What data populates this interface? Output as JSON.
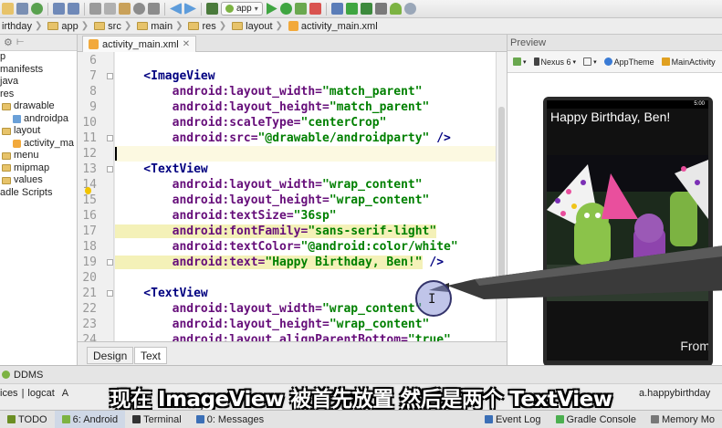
{
  "toolbar": {
    "run_config": "app",
    "icon_names": [
      "folder-open-icon",
      "save-icon",
      "sync-icon",
      "undo-icon",
      "redo-icon",
      "cut-icon",
      "copy-icon",
      "paste-icon",
      "find-icon",
      "replace-icon",
      "back-icon",
      "forward-icon",
      "build-icon",
      "run-icon",
      "debug-icon",
      "attach-debugger-icon",
      "stop-icon",
      "project-structure-icon",
      "sdk-manager-icon",
      "android-device-icon"
    ]
  },
  "breadcrumb": [
    "irthday",
    "app",
    "src",
    "main",
    "res",
    "layout",
    "activity_main.xml"
  ],
  "project_tree": [
    {
      "label": "p",
      "indent": 0,
      "icon": "module-icon"
    },
    {
      "label": "manifests",
      "indent": 0,
      "icon": "folder-icon"
    },
    {
      "label": "java",
      "indent": 0,
      "icon": "folder-icon"
    },
    {
      "label": "res",
      "indent": 0,
      "icon": "folder-icon"
    },
    {
      "label": "drawable",
      "indent": 1,
      "icon": "folder-icon"
    },
    {
      "label": "androidpa",
      "indent": 2,
      "icon": "image-file-icon"
    },
    {
      "label": "layout",
      "indent": 1,
      "icon": "folder-icon"
    },
    {
      "label": "activity_ma",
      "indent": 2,
      "icon": "xml-file-icon"
    },
    {
      "label": "menu",
      "indent": 1,
      "icon": "folder-icon"
    },
    {
      "label": "mipmap",
      "indent": 1,
      "icon": "folder-icon"
    },
    {
      "label": "values",
      "indent": 1,
      "icon": "folder-icon"
    },
    {
      "label": "adle Scripts",
      "indent": 0,
      "icon": "gradle-icon"
    }
  ],
  "editor": {
    "tab_label": "activity_main.xml",
    "lines": [
      {
        "n": "6",
        "parts": []
      },
      {
        "n": "7",
        "parts": [
          {
            "t": "    <",
            "c": "tag"
          },
          {
            "t": "ImageView",
            "c": "tag"
          }
        ]
      },
      {
        "n": "8",
        "parts": [
          {
            "t": "        android:layout_width=",
            "c": "attr"
          },
          {
            "t": "\"match_parent\"",
            "c": "val"
          }
        ]
      },
      {
        "n": "9",
        "parts": [
          {
            "t": "        android:layout_height=",
            "c": "attr"
          },
          {
            "t": "\"match_parent\"",
            "c": "val"
          }
        ]
      },
      {
        "n": "10",
        "parts": [
          {
            "t": "        android:scaleType=",
            "c": "attr"
          },
          {
            "t": "\"centerCrop\"",
            "c": "val"
          }
        ]
      },
      {
        "n": "11",
        "parts": [
          {
            "t": "        android:src=",
            "c": "attr"
          },
          {
            "t": "\"@drawable/androidparty\"",
            "c": "val"
          },
          {
            "t": " />",
            "c": "tag"
          }
        ]
      },
      {
        "n": "12",
        "parts": [],
        "caret": true
      },
      {
        "n": "13",
        "parts": [
          {
            "t": "    <",
            "c": "tag"
          },
          {
            "t": "TextView",
            "c": "tag"
          }
        ]
      },
      {
        "n": "14",
        "parts": [
          {
            "t": "        android:layout_width=",
            "c": "attr"
          },
          {
            "t": "\"wrap_content\"",
            "c": "val"
          }
        ]
      },
      {
        "n": "15",
        "parts": [
          {
            "t": "        android:layout_height=",
            "c": "attr"
          },
          {
            "t": "\"wrap_content\"",
            "c": "val"
          }
        ]
      },
      {
        "n": "16",
        "parts": [
          {
            "t": "        android:textSize=",
            "c": "attr"
          },
          {
            "t": "\"36sp\"",
            "c": "val"
          }
        ]
      },
      {
        "n": "17",
        "parts": [
          {
            "t": "        android:fontFamily=",
            "c": "attr",
            "h": true
          },
          {
            "t": "\"sans-serif-light\"",
            "c": "val",
            "h": true
          }
        ]
      },
      {
        "n": "18",
        "parts": [
          {
            "t": "        android:textColor=",
            "c": "attr"
          },
          {
            "t": "\"@android:color/white\"",
            "c": "val"
          }
        ]
      },
      {
        "n": "19",
        "parts": [
          {
            "t": "        android:text=",
            "c": "attr",
            "h": true
          },
          {
            "t": "\"Happy Birthday, Ben!\"",
            "c": "val",
            "h": true
          },
          {
            "t": " />",
            "c": "tag"
          }
        ]
      },
      {
        "n": "20",
        "parts": []
      },
      {
        "n": "21",
        "parts": [
          {
            "t": "    <",
            "c": "tag"
          },
          {
            "t": "TextView",
            "c": "tag"
          }
        ]
      },
      {
        "n": "22",
        "parts": [
          {
            "t": "        android:layout_width=",
            "c": "attr"
          },
          {
            "t": "\"wrap_content\"",
            "c": "val"
          }
        ]
      },
      {
        "n": "23",
        "parts": [
          {
            "t": "        android:layout_height=",
            "c": "attr"
          },
          {
            "t": "\"wrap_content\"",
            "c": "val"
          }
        ]
      },
      {
        "n": "24",
        "parts": [
          {
            "t": "        android:layout_alignParentBottom=",
            "c": "attr"
          },
          {
            "t": "\"true\"",
            "c": "val"
          }
        ]
      }
    ],
    "mode_tabs": [
      "Design",
      "Text"
    ],
    "active_mode": "Text"
  },
  "preview": {
    "title": "Preview",
    "device": "Nexus 6",
    "theme": "AppTheme",
    "activity": "MainActivity",
    "status_time": "5:00",
    "happy_text": "Happy Birthday, Ben!",
    "from_text": "From"
  },
  "ddms": {
    "label": "DDMS",
    "tabs": [
      "ices",
      "logcat",
      "A"
    ],
    "filter_text": "a.happybirthday"
  },
  "subtitle": "现在 ImageView 被首先放置 然后是两个 TextView",
  "bottom_bar": [
    {
      "label": "TODO",
      "icon": "todo-icon",
      "color": "#6b8e23"
    },
    {
      "label": "6: Android",
      "icon": "android-icon",
      "color": "#7cb342",
      "active": true
    },
    {
      "label": "Terminal",
      "icon": "terminal-icon",
      "color": "#333333"
    },
    {
      "label": "0: Messages",
      "icon": "messages-icon",
      "color": "#3b6fb6"
    },
    {
      "label": "Event Log",
      "icon": "event-log-icon",
      "color": "#3b6fb6"
    },
    {
      "label": "Gradle Console",
      "icon": "gradle-console-icon",
      "color": "#4caf50"
    },
    {
      "label": "Memory Mo",
      "icon": "memory-monitor-icon",
      "color": "#777777"
    }
  ],
  "colors": {
    "tag": "#000080",
    "attribute": "#660e7a",
    "string": "#008000",
    "highlight": "#f4f1b8"
  }
}
